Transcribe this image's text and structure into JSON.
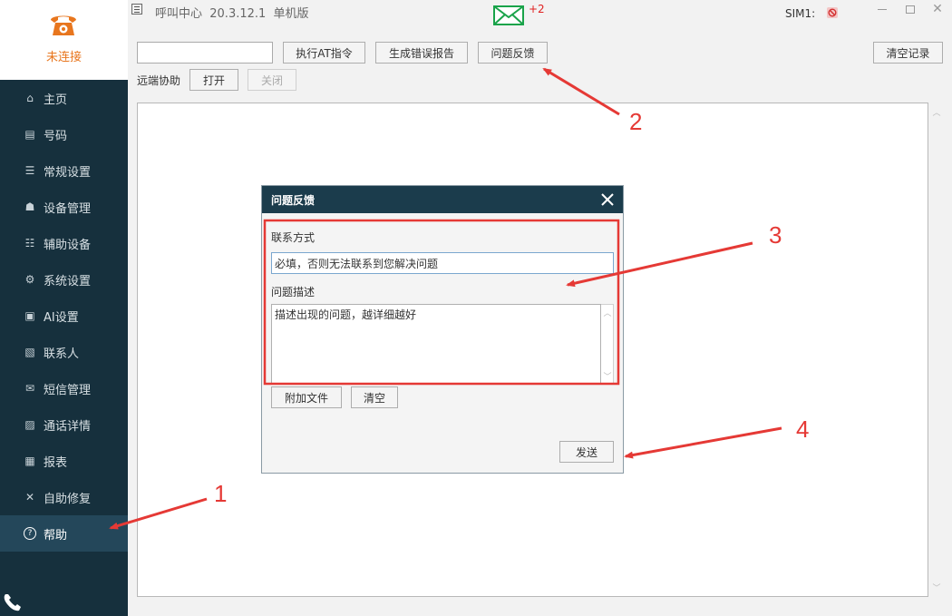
{
  "sidebar": {
    "status": "未连接",
    "items": [
      {
        "label": "主页",
        "icon": "home-icon",
        "glyph": "⌂"
      },
      {
        "label": "号码",
        "icon": "document-icon",
        "glyph": "▤"
      },
      {
        "label": "常规设置",
        "icon": "sliders-icon",
        "glyph": "☰"
      },
      {
        "label": "设备管理",
        "icon": "device-icon",
        "glyph": "☗"
      },
      {
        "label": "辅助设备",
        "icon": "aux-device-icon",
        "glyph": "☷"
      },
      {
        "label": "系统设置",
        "icon": "gear-icon",
        "glyph": "⚙"
      },
      {
        "label": "AI设置",
        "icon": "ai-icon",
        "glyph": "▣"
      },
      {
        "label": "联系人",
        "icon": "contact-icon",
        "glyph": "▧"
      },
      {
        "label": "短信管理",
        "icon": "mail-icon",
        "glyph": "✉"
      },
      {
        "label": "通话详情",
        "icon": "call-detail-icon",
        "glyph": "▨"
      },
      {
        "label": "报表",
        "icon": "chart-icon",
        "glyph": "▦"
      },
      {
        "label": "自助修复",
        "icon": "tools-icon",
        "glyph": "✕"
      },
      {
        "label": "帮助",
        "icon": "help-icon",
        "glyph": "?"
      }
    ],
    "active_index": 12
  },
  "titlebar": {
    "title": "呼叫中心  20.3.12.1  单机版",
    "mail_count": "+2",
    "sim_label": "SIM1:",
    "minimize_glyph": "▭",
    "restore_glyph": "▭",
    "close_glyph": "✕"
  },
  "toolbar": {
    "at_input_value": "",
    "at_button": "执行AT指令",
    "error_report_button": "生成错误报告",
    "feedback_button": "问题反馈",
    "clear_log_button": "清空记录",
    "remote_label": "远端协助",
    "open_button": "打开",
    "close_button": "关闭"
  },
  "dialog": {
    "title": "问题反馈",
    "contact_label": "联系方式",
    "contact_value": "必填，否则无法联系到您解决问题",
    "desc_label": "问题描述",
    "desc_value": "描述出现的问题，越详细越好",
    "attach_button": "附加文件",
    "clear_button": "清空",
    "send_button": "发送"
  },
  "annotations": {
    "colors": {
      "arrow": "#e53935"
    },
    "labels": [
      "1",
      "2",
      "3",
      "4"
    ]
  },
  "colors": {
    "sidebar_bg": "#16303d",
    "sidebar_active": "#24475a",
    "status_orange": "#e8761e",
    "dialog_header": "#1b3c4c",
    "mail_green": "#1aa34a"
  }
}
